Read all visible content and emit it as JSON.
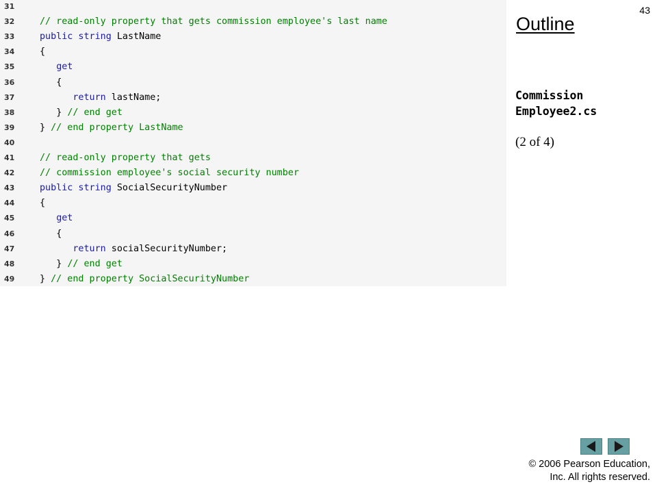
{
  "slide": {
    "number": "43",
    "outline_title": "Outline",
    "file_name_line1": "Commission",
    "file_name_line2": "Employee2.cs",
    "part_label": "(2 of 4)",
    "copyright_line1": "© 2006 Pearson Education,",
    "copyright_line2": "Inc.  All rights reserved."
  },
  "navigation": {
    "prev_icon": "triangle-left-icon",
    "next_icon": "triangle-right-icon",
    "button_color": "#67a0a3"
  },
  "colors": {
    "keyword": "#1a1aa6",
    "comment": "#008000",
    "panel_background": "#f5f5f5"
  },
  "code_lines": [
    {
      "num": "31",
      "indent": "",
      "tokens": []
    },
    {
      "num": "32",
      "indent": "",
      "tokens": [
        {
          "t": "cm",
          "v": "// read-only property that gets commission employee's last name"
        }
      ]
    },
    {
      "num": "33",
      "indent": "",
      "tokens": [
        {
          "t": "kw",
          "v": "public string"
        },
        {
          "t": "tx",
          "v": " LastName"
        }
      ]
    },
    {
      "num": "34",
      "indent": "",
      "tokens": [
        {
          "t": "tx",
          "v": "{"
        }
      ]
    },
    {
      "num": "35",
      "indent": "   ",
      "tokens": [
        {
          "t": "kw",
          "v": "get"
        }
      ]
    },
    {
      "num": "36",
      "indent": "   ",
      "tokens": [
        {
          "t": "tx",
          "v": "{"
        }
      ]
    },
    {
      "num": "37",
      "indent": "      ",
      "tokens": [
        {
          "t": "kw",
          "v": "return"
        },
        {
          "t": "tx",
          "v": " lastName;"
        }
      ]
    },
    {
      "num": "38",
      "indent": "   ",
      "tokens": [
        {
          "t": "tx",
          "v": "} "
        },
        {
          "t": "cm",
          "v": "// end get"
        }
      ]
    },
    {
      "num": "39",
      "indent": "",
      "tokens": [
        {
          "t": "tx",
          "v": "} "
        },
        {
          "t": "cm",
          "v": "// end property LastName"
        }
      ]
    },
    {
      "num": "40",
      "indent": "",
      "tokens": []
    },
    {
      "num": "41",
      "indent": "",
      "tokens": [
        {
          "t": "cm",
          "v": "// read-only property that gets"
        }
      ]
    },
    {
      "num": "42",
      "indent": "",
      "tokens": [
        {
          "t": "cm",
          "v": "// commission employee's social security number"
        }
      ]
    },
    {
      "num": "43",
      "indent": "",
      "tokens": [
        {
          "t": "kw",
          "v": "public string"
        },
        {
          "t": "tx",
          "v": " SocialSecurityNumber"
        }
      ]
    },
    {
      "num": "44",
      "indent": "",
      "tokens": [
        {
          "t": "tx",
          "v": "{"
        }
      ]
    },
    {
      "num": "45",
      "indent": "   ",
      "tokens": [
        {
          "t": "kw",
          "v": "get"
        }
      ]
    },
    {
      "num": "46",
      "indent": "   ",
      "tokens": [
        {
          "t": "tx",
          "v": "{"
        }
      ]
    },
    {
      "num": "47",
      "indent": "      ",
      "tokens": [
        {
          "t": "kw",
          "v": "return"
        },
        {
          "t": "tx",
          "v": " socialSecurityNumber;"
        }
      ]
    },
    {
      "num": "48",
      "indent": "   ",
      "tokens": [
        {
          "t": "tx",
          "v": "} "
        },
        {
          "t": "cm",
          "v": "// end get"
        }
      ]
    },
    {
      "num": "49",
      "indent": "",
      "tokens": [
        {
          "t": "tx",
          "v": "} "
        },
        {
          "t": "cm",
          "v": "// end property SocialSecurityNumber"
        }
      ]
    }
  ]
}
